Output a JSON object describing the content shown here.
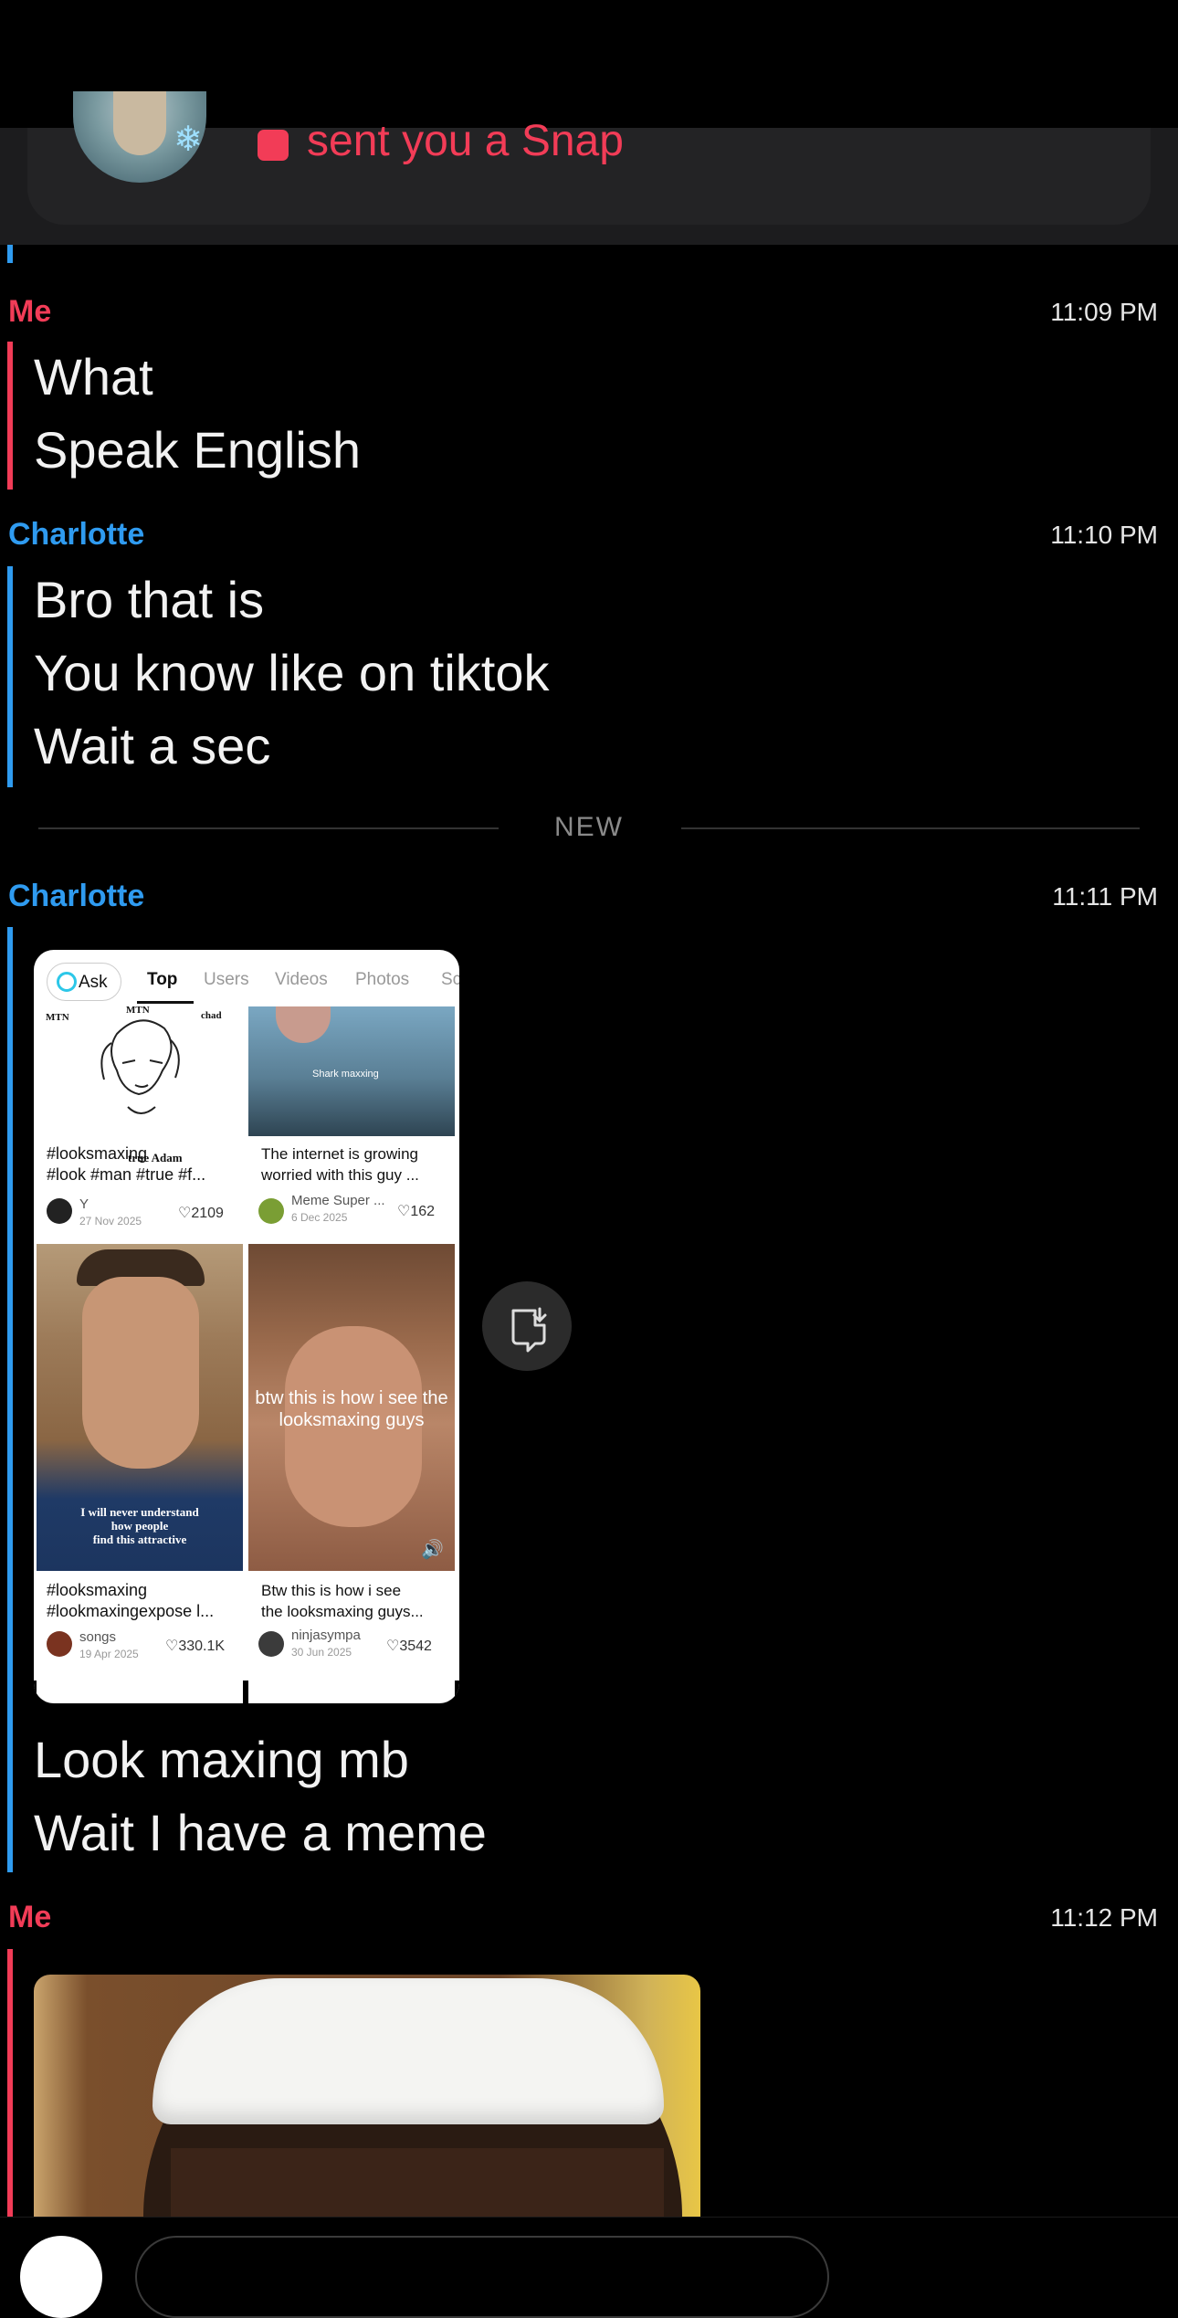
{
  "notification": {
    "text": "sent you a Snap",
    "accent": "#f23c57"
  },
  "colors": {
    "me": "#f23c57",
    "charlotte": "#2f9bf0",
    "background": "#000000"
  },
  "messages": [
    {
      "sender": "Me",
      "time": "11:09 PM",
      "lines": [
        "What",
        "Speak English"
      ]
    },
    {
      "sender": "Charlotte",
      "time": "11:10 PM",
      "lines": [
        "Bro that is",
        "You know like on tiktok",
        "Wait a sec"
      ]
    },
    {
      "sender": "Charlotte",
      "time": "11:11 PM",
      "lines": [
        "Look maxing mb",
        "Wait I have a meme"
      ]
    },
    {
      "sender": "Me",
      "time": "11:12 PM",
      "lines": []
    }
  ],
  "divider": {
    "label": "NEW"
  },
  "tiktok": {
    "ask": "Ask",
    "tabs": [
      "Top",
      "Users",
      "Videos",
      "Photos",
      "Sc"
    ],
    "tiles": [
      {
        "thumb_texts": [
          "MTN",
          "MTN",
          "chad",
          "true Adam"
        ],
        "caption": [
          "#looksmaxing",
          "#look #man #true #f..."
        ],
        "user": "Y",
        "date": "27 Nov 2025",
        "likes": "2109"
      },
      {
        "thumb_texts": [
          "Shark maxxing"
        ],
        "caption": [
          "The internet is growing",
          "worried with this guy ..."
        ],
        "user": "Meme Super ...",
        "date": "6 Dec 2025",
        "likes": "162"
      },
      {
        "thumb_texts": [
          "I will never understand",
          "how people",
          "find this attractive"
        ],
        "caption": [
          "#looksmaxing",
          "#lookmaxingexpose l..."
        ],
        "user": "songs",
        "date": "19 Apr 2025",
        "likes": "330.1K"
      },
      {
        "thumb_texts": [
          "btw this is how i see the",
          "looksmaxing guys"
        ],
        "caption": [
          "Btw this is how i see",
          "the looksmaxing guys..."
        ],
        "user": "ninjasympa",
        "date": "30 Jun 2025",
        "likes": "3542"
      }
    ]
  }
}
